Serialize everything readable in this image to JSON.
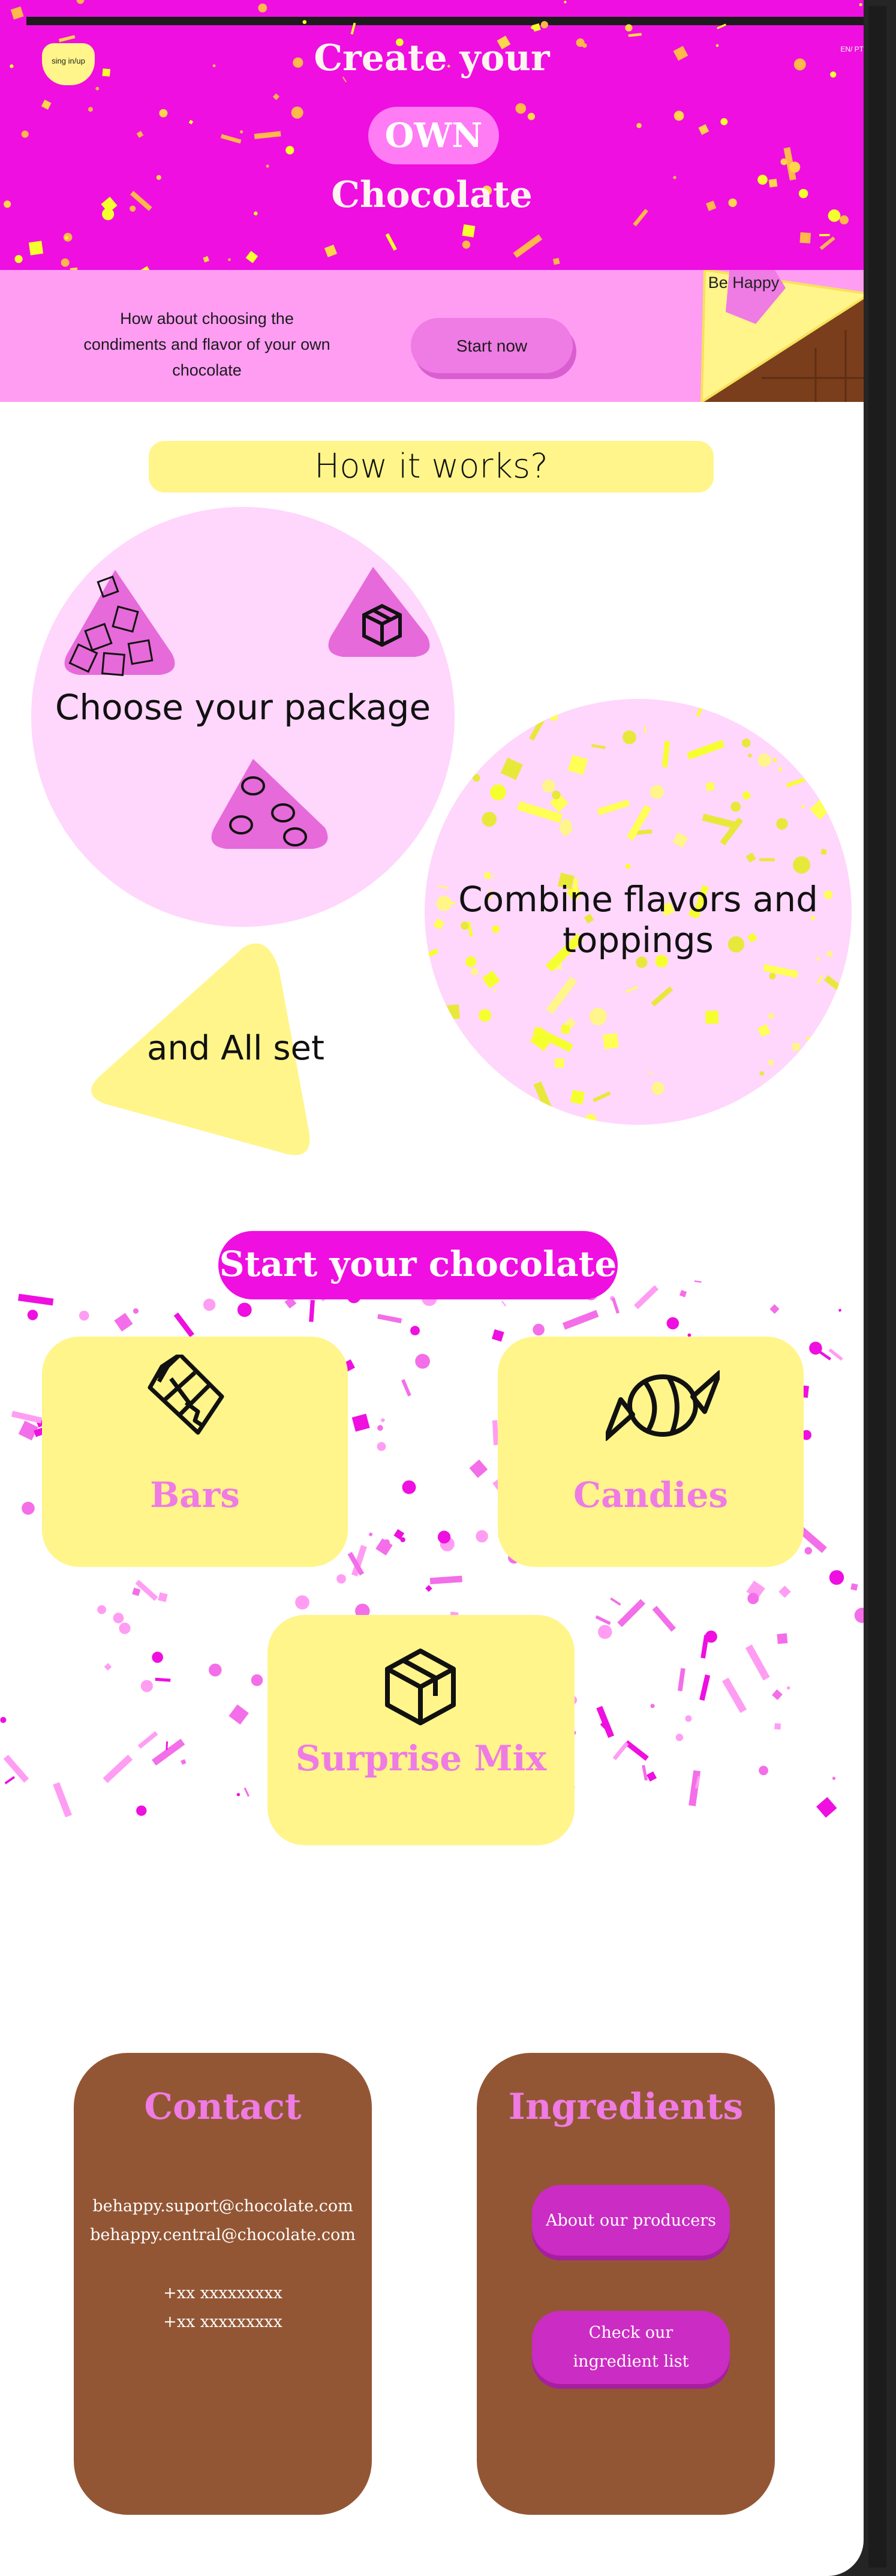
{
  "header": {
    "signin_label": "sing in/up",
    "lang_label": "EN/ PT",
    "title_line1": "Create your",
    "title_own": "OWN",
    "title_line3": "Chocolate",
    "hero_color": "#ee0fe0",
    "confetti_color": "#f6ff2e"
  },
  "intro": {
    "text": "How about choosing the condiments and flavor of your own chocolate",
    "start_label": "Start now",
    "badge_label": "Be Happy"
  },
  "how": {
    "title": "How it works?",
    "step1": "Choose your package",
    "step2": "Combine flavors and toppings",
    "step3": "and All set"
  },
  "start": {
    "title": "Start your chocolate",
    "cards": [
      {
        "label": "Bars",
        "icon": "chocolate-bar-icon"
      },
      {
        "label": "Candies",
        "icon": "candy-icon"
      },
      {
        "label": "Surprise Mix",
        "icon": "box-icon"
      }
    ]
  },
  "footer": {
    "contact_title": "Contact",
    "email1": "behappy.suport@chocolate.com",
    "email2": "behappy.central@chocolate.com",
    "phone1": "+xx xxxxxxxxx",
    "phone2": "+xx xxxxxxxxx",
    "ingredients_title": "Ingredients",
    "producers_label": "About our producers",
    "ingredient_list_label": "Check our ingredient list"
  },
  "colors": {
    "pink": "#ee0fe0",
    "light_pink": "#ff9df3",
    "yellow": "#fff58a",
    "brown": "#935634"
  }
}
